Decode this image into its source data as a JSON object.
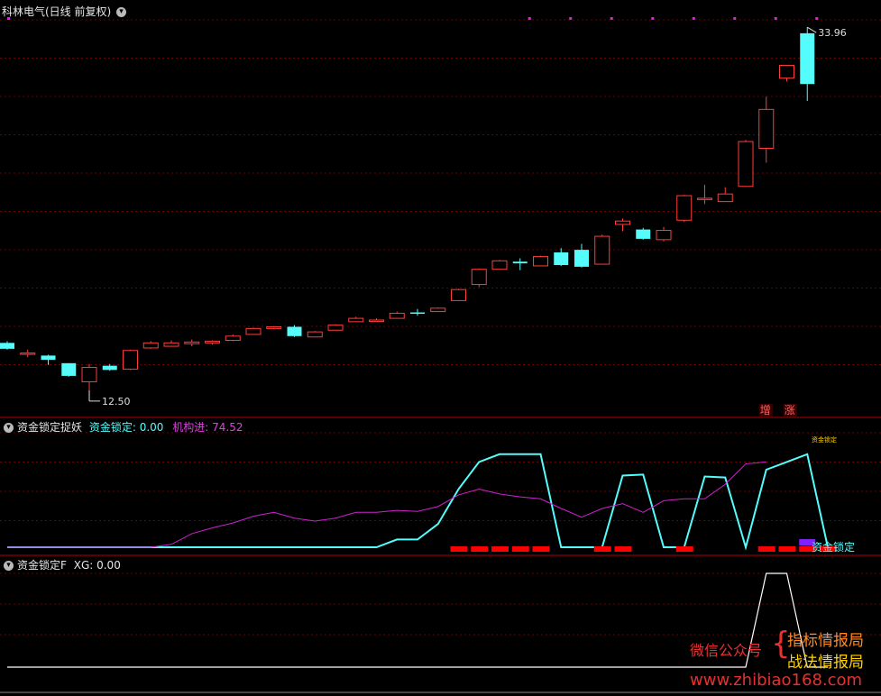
{
  "header_main": {
    "title": "科林电气(日线 前复权)",
    "menu_glyph": "▾"
  },
  "header_ind1": {
    "title": "资金锁定捉妖",
    "lock_label": "资金锁定: 0.00",
    "inst_label": "机构进: 74.52"
  },
  "header_ind2": {
    "title": "资金锁定F",
    "xg_label": "XG: 0.00"
  },
  "watermark": {
    "left": "微信公众号",
    "brace": "{",
    "line1": "指标情报局",
    "line2": "战法情报局",
    "url": "www.zhibiao168.com"
  },
  "colors": {
    "background": "#000000",
    "up": "#ff3c3c",
    "down": "#54fcfc",
    "grid": "#6e0000",
    "border": "#b40000",
    "lock_line": "#54fcfc",
    "inst_line": "#d020d0",
    "xg_line": "#ffffff",
    "bar_red": "#ff0000",
    "bar_purple": "#8020ff"
  },
  "chart_data": [
    {
      "type": "candlestick",
      "title": "科林电气(日线 前复权)",
      "ylim": [
        11.8,
        34.5
      ],
      "annotations": {
        "high": "33.96",
        "low": "12.50",
        "labels": [
          "增",
          "涨"
        ]
      },
      "candles": [
        {
          "o": 15.3,
          "h": 15.4,
          "l": 14.9,
          "c": 14.95
        },
        {
          "o": 14.7,
          "h": 14.9,
          "l": 14.45,
          "c": 14.7
        },
        {
          "o": 14.55,
          "h": 14.6,
          "l": 14.0,
          "c": 14.3
        },
        {
          "o": 14.1,
          "h": 14.1,
          "l": 13.3,
          "c": 13.35
        },
        {
          "o": 13.0,
          "h": 14.05,
          "l": 12.5,
          "c": 13.85
        },
        {
          "o": 13.95,
          "h": 14.05,
          "l": 13.65,
          "c": 13.7
        },
        {
          "o": 13.75,
          "h": 14.9,
          "l": 13.7,
          "c": 14.85
        },
        {
          "o": 15.0,
          "h": 15.4,
          "l": 14.95,
          "c": 15.3
        },
        {
          "o": 15.1,
          "h": 15.45,
          "l": 15.1,
          "c": 15.3
        },
        {
          "o": 15.25,
          "h": 15.5,
          "l": 15.1,
          "c": 15.35
        },
        {
          "o": 15.3,
          "h": 15.45,
          "l": 15.2,
          "c": 15.4
        },
        {
          "o": 15.45,
          "h": 15.8,
          "l": 15.4,
          "c": 15.7
        },
        {
          "o": 15.8,
          "h": 16.2,
          "l": 15.8,
          "c": 16.15
        },
        {
          "o": 16.15,
          "h": 16.3,
          "l": 16.1,
          "c": 16.25
        },
        {
          "o": 16.25,
          "h": 16.35,
          "l": 15.65,
          "c": 15.7
        },
        {
          "o": 15.65,
          "h": 16.0,
          "l": 15.65,
          "c": 15.95
        },
        {
          "o": 16.05,
          "h": 16.4,
          "l": 16.05,
          "c": 16.35
        },
        {
          "o": 16.55,
          "h": 16.85,
          "l": 16.55,
          "c": 16.75
        },
        {
          "o": 16.6,
          "h": 16.75,
          "l": 16.6,
          "c": 16.65
        },
        {
          "o": 16.75,
          "h": 17.15,
          "l": 16.75,
          "c": 17.05
        },
        {
          "o": 17.1,
          "h": 17.3,
          "l": 16.9,
          "c": 17.05
        },
        {
          "o": 17.15,
          "h": 17.4,
          "l": 17.15,
          "c": 17.35
        },
        {
          "o": 17.8,
          "h": 18.5,
          "l": 17.8,
          "c": 18.45
        },
        {
          "o": 18.75,
          "h": 19.7,
          "l": 18.6,
          "c": 19.65
        },
        {
          "o": 19.65,
          "h": 20.2,
          "l": 19.65,
          "c": 20.15
        },
        {
          "o": 20.1,
          "h": 20.3,
          "l": 19.6,
          "c": 20.0
        },
        {
          "o": 19.85,
          "h": 20.45,
          "l": 19.85,
          "c": 20.4
        },
        {
          "o": 20.65,
          "h": 20.9,
          "l": 19.85,
          "c": 19.9
        },
        {
          "o": 20.8,
          "h": 21.15,
          "l": 19.75,
          "c": 19.8
        },
        {
          "o": 19.95,
          "h": 21.7,
          "l": 19.95,
          "c": 21.6
        },
        {
          "o": 22.3,
          "h": 22.65,
          "l": 21.9,
          "c": 22.5
        },
        {
          "o": 22.0,
          "h": 22.1,
          "l": 21.4,
          "c": 21.45
        },
        {
          "o": 21.4,
          "h": 22.15,
          "l": 21.3,
          "c": 21.95
        },
        {
          "o": 22.55,
          "h": 24.05,
          "l": 22.45,
          "c": 24.0
        },
        {
          "o": 23.85,
          "h": 24.65,
          "l": 23.5,
          "c": 23.85
        },
        {
          "o": 23.65,
          "h": 24.5,
          "l": 23.65,
          "c": 24.1
        },
        {
          "o": 24.55,
          "h": 27.3,
          "l": 24.55,
          "c": 27.2
        },
        {
          "o": 26.8,
          "h": 29.85,
          "l": 25.95,
          "c": 29.1
        },
        {
          "o": 30.95,
          "h": 31.65,
          "l": 30.75,
          "c": 31.7
        },
        {
          "o": 33.6,
          "h": 33.96,
          "l": 29.6,
          "c": 30.6
        }
      ]
    },
    {
      "type": "line",
      "title": "资金锁定捉妖",
      "ylim": [
        0,
        120
      ],
      "series": [
        {
          "name": "资金锁定",
          "values": [
            0,
            0,
            0,
            0,
            0,
            0,
            0,
            0,
            0,
            0,
            0,
            0,
            0,
            0,
            0,
            0,
            0,
            0,
            0,
            8,
            8,
            24,
            60,
            88,
            96,
            96,
            96,
            0,
            0,
            0,
            74,
            75,
            0,
            0,
            73,
            72,
            0,
            80,
            88,
            96,
            0
          ]
        },
        {
          "name": "机构进",
          "values": [
            0,
            0,
            0,
            0,
            0,
            0,
            0,
            0,
            3,
            14,
            20,
            25,
            32,
            36,
            30,
            27,
            30,
            36,
            36,
            38,
            37,
            42,
            54,
            60,
            55,
            52,
            50,
            40,
            31,
            40,
            45,
            36,
            48,
            50,
            50,
            65,
            86,
            88
          ]
        }
      ],
      "signal_bars": {
        "red": [
          22,
          23,
          24,
          25,
          26,
          29,
          30,
          33,
          37,
          38,
          39,
          40
        ],
        "purple": [
          39
        ]
      },
      "labels": [
        "资金锁定",
        "资金锁定"
      ]
    },
    {
      "type": "line",
      "title": "资金锁定F",
      "series": [
        {
          "name": "XG",
          "values": [
            0,
            0,
            0,
            0,
            0,
            0,
            0,
            0,
            0,
            0,
            0,
            0,
            0,
            0,
            0,
            0,
            0,
            0,
            0,
            0,
            0,
            0,
            0,
            0,
            0,
            0,
            0,
            0,
            0,
            0,
            0,
            0,
            0,
            0,
            0,
            0,
            0,
            1,
            1,
            0,
            0
          ]
        }
      ],
      "ylim": [
        0,
        1
      ]
    }
  ]
}
